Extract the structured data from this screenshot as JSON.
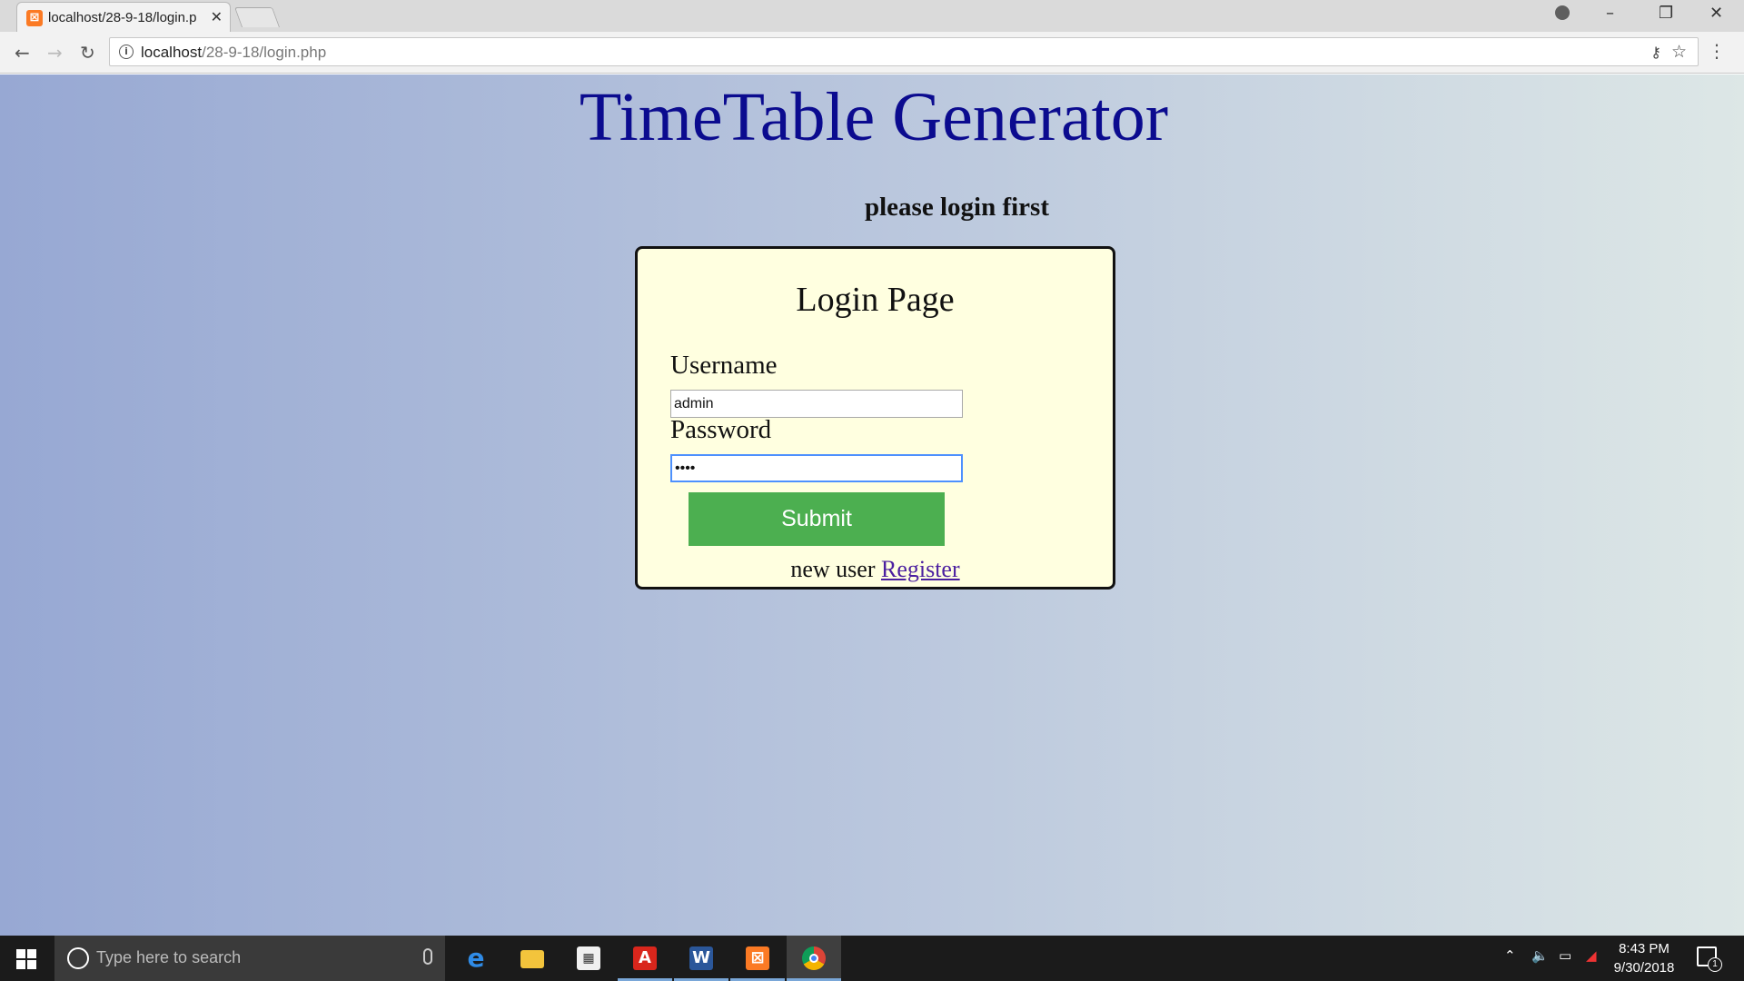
{
  "browser": {
    "tab_title": "localhost/28-9-18/login.p",
    "url_host": "localhost",
    "url_path": "/28-9-18/login.php"
  },
  "page": {
    "site_title": "TimeTable Generator",
    "notice": "please login first",
    "login": {
      "heading": "Login Page",
      "username_label": "Username",
      "username_value": "admin",
      "password_label": "Password",
      "password_value": "••••",
      "submit_label": "Submit",
      "new_user_text": "new user",
      "register_link": "Register"
    }
  },
  "taskbar": {
    "search_placeholder": "Type here to search",
    "apps": [
      "edge-icon",
      "file-explorer-icon",
      "store-icon",
      "acrobat-icon",
      "word-icon",
      "xampp-icon",
      "chrome-icon"
    ],
    "time": "8:43 PM",
    "date": "9/30/2018",
    "notification_count": "1"
  },
  "colors": {
    "title": "#0b0b8f",
    "login_box_bg": "#ffffe0",
    "submit_bg": "#4caf50",
    "link": "#4b1fa0"
  }
}
